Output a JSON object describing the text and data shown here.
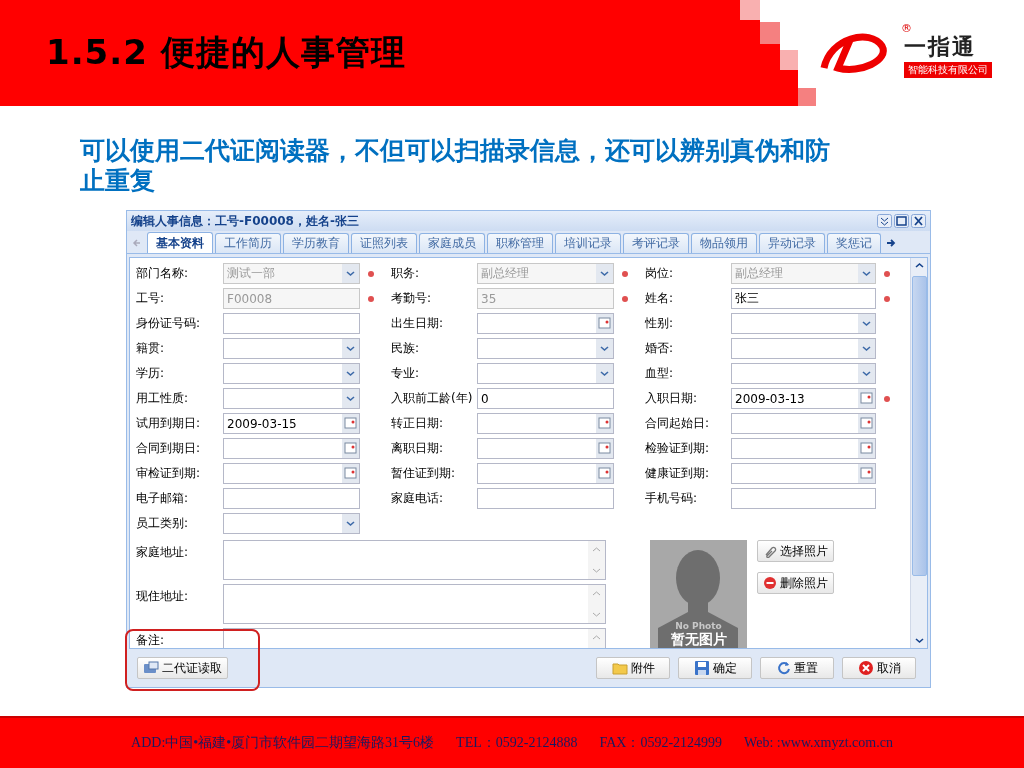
{
  "slide": {
    "title": "1.5.2 便捷的人事管理",
    "logo": {
      "mark": "®",
      "name": "一指通",
      "subtitle": "智能科技有限公司"
    },
    "description": "可以使用二代证阅读器，不但可以扫描录信息，还可以辨别真伪和防止重复"
  },
  "window": {
    "title": "编辑人事信息：工号-F00008，姓名-张三",
    "tabs": [
      {
        "label": "基本资料",
        "selected": true
      },
      {
        "label": "工作简历",
        "selected": false
      },
      {
        "label": "学历教育",
        "selected": false
      },
      {
        "label": "证照列表",
        "selected": false
      },
      {
        "label": "家庭成员",
        "selected": false
      },
      {
        "label": "职称管理",
        "selected": false
      },
      {
        "label": "培训记录",
        "selected": false
      },
      {
        "label": "考评记录",
        "selected": false
      },
      {
        "label": "物品领用",
        "selected": false
      },
      {
        "label": "异动记录",
        "selected": false
      },
      {
        "label": "奖惩记",
        "selected": false
      }
    ],
    "fields": [
      {
        "label": "部门名称:",
        "kind": "select",
        "value": "测试一部",
        "disabled": true,
        "required": true
      },
      {
        "label": "职务:",
        "kind": "select",
        "value": "副总经理",
        "disabled": true,
        "required": true
      },
      {
        "label": "岗位:",
        "kind": "select",
        "value": "副总经理",
        "disabled": true,
        "required": true
      },
      {
        "label": "工号:",
        "kind": "text",
        "value": "F00008",
        "disabled": true,
        "required": true
      },
      {
        "label": "考勤号:",
        "kind": "text",
        "value": "35",
        "disabled": true,
        "required": true
      },
      {
        "label": "姓名:",
        "kind": "text",
        "value": "张三",
        "disabled": false,
        "required": true
      },
      {
        "label": "身份证号码:",
        "kind": "text",
        "disabled": false,
        "required": false
      },
      {
        "label": "出生日期:",
        "kind": "date",
        "disabled": false,
        "required": false
      },
      {
        "label": "性别:",
        "kind": "select",
        "disabled": false,
        "required": false
      },
      {
        "label": "籍贯:",
        "kind": "select",
        "disabled": false,
        "required": false
      },
      {
        "label": "民族:",
        "kind": "select",
        "disabled": false,
        "required": false
      },
      {
        "label": "婚否:",
        "kind": "select",
        "disabled": false,
        "required": false
      },
      {
        "label": "学历:",
        "kind": "select",
        "disabled": false,
        "required": false
      },
      {
        "label": "专业:",
        "kind": "select",
        "disabled": false,
        "required": false
      },
      {
        "label": "血型:",
        "kind": "select",
        "disabled": false,
        "required": false
      },
      {
        "label": "用工性质:",
        "kind": "select",
        "disabled": false,
        "required": false
      },
      {
        "label": "入职前工龄(年)",
        "kind": "text",
        "value": "0",
        "disabled": false,
        "required": false
      },
      {
        "label": "入职日期:",
        "kind": "date",
        "value": "2009-03-13",
        "disabled": false,
        "required": true
      },
      {
        "label": "试用到期日:",
        "kind": "date",
        "value": "2009-03-15",
        "disabled": false,
        "required": false
      },
      {
        "label": "转正日期:",
        "kind": "date",
        "disabled": false,
        "required": false
      },
      {
        "label": "合同起始日:",
        "kind": "date",
        "disabled": false,
        "required": false
      },
      {
        "label": "合同到期日:",
        "kind": "date",
        "disabled": false,
        "required": false
      },
      {
        "label": "离职日期:",
        "kind": "date",
        "disabled": false,
        "required": false
      },
      {
        "label": "检验证到期:",
        "kind": "date",
        "disabled": false,
        "required": false
      },
      {
        "label": "审检证到期:",
        "kind": "date",
        "disabled": false,
        "required": false
      },
      {
        "label": "暂住证到期:",
        "kind": "date",
        "disabled": false,
        "required": false
      },
      {
        "label": "健康证到期:",
        "kind": "date",
        "disabled": false,
        "required": false
      },
      {
        "label": "电子邮箱:",
        "kind": "text",
        "disabled": false,
        "required": false
      },
      {
        "label": "家庭电话:",
        "kind": "text",
        "disabled": false,
        "required": false
      },
      {
        "label": "手机号码:",
        "kind": "text",
        "disabled": false,
        "required": false
      },
      {
        "label": "员工类别:",
        "kind": "select",
        "disabled": false,
        "required": false
      }
    ],
    "textareas": [
      {
        "label": "家庭地址:"
      },
      {
        "label": "现住地址:"
      },
      {
        "label": "备注:"
      }
    ],
    "photo": {
      "caption_en": "No Photo",
      "caption": "暂无图片",
      "buttons": [
        {
          "label": "选择照片",
          "kind": "attach"
        },
        {
          "label": "删除照片",
          "kind": "delete"
        }
      ]
    },
    "footer_buttons": [
      {
        "label": "二代证读取",
        "kind": "idcard",
        "highlighted": true
      }
    ],
    "actions": [
      {
        "label": "附件",
        "kind": "folder"
      },
      {
        "label": "确定",
        "kind": "save"
      },
      {
        "label": "重置",
        "kind": "reset"
      },
      {
        "label": "取消",
        "kind": "cancel"
      }
    ]
  },
  "footer": [
    "ADD:中国•福建•厦门市软件园二期望海路31号6楼",
    "TEL：0592-2124888",
    "FAX：0592-2124999",
    "Web: :www.xmyzt.com.cn"
  ]
}
